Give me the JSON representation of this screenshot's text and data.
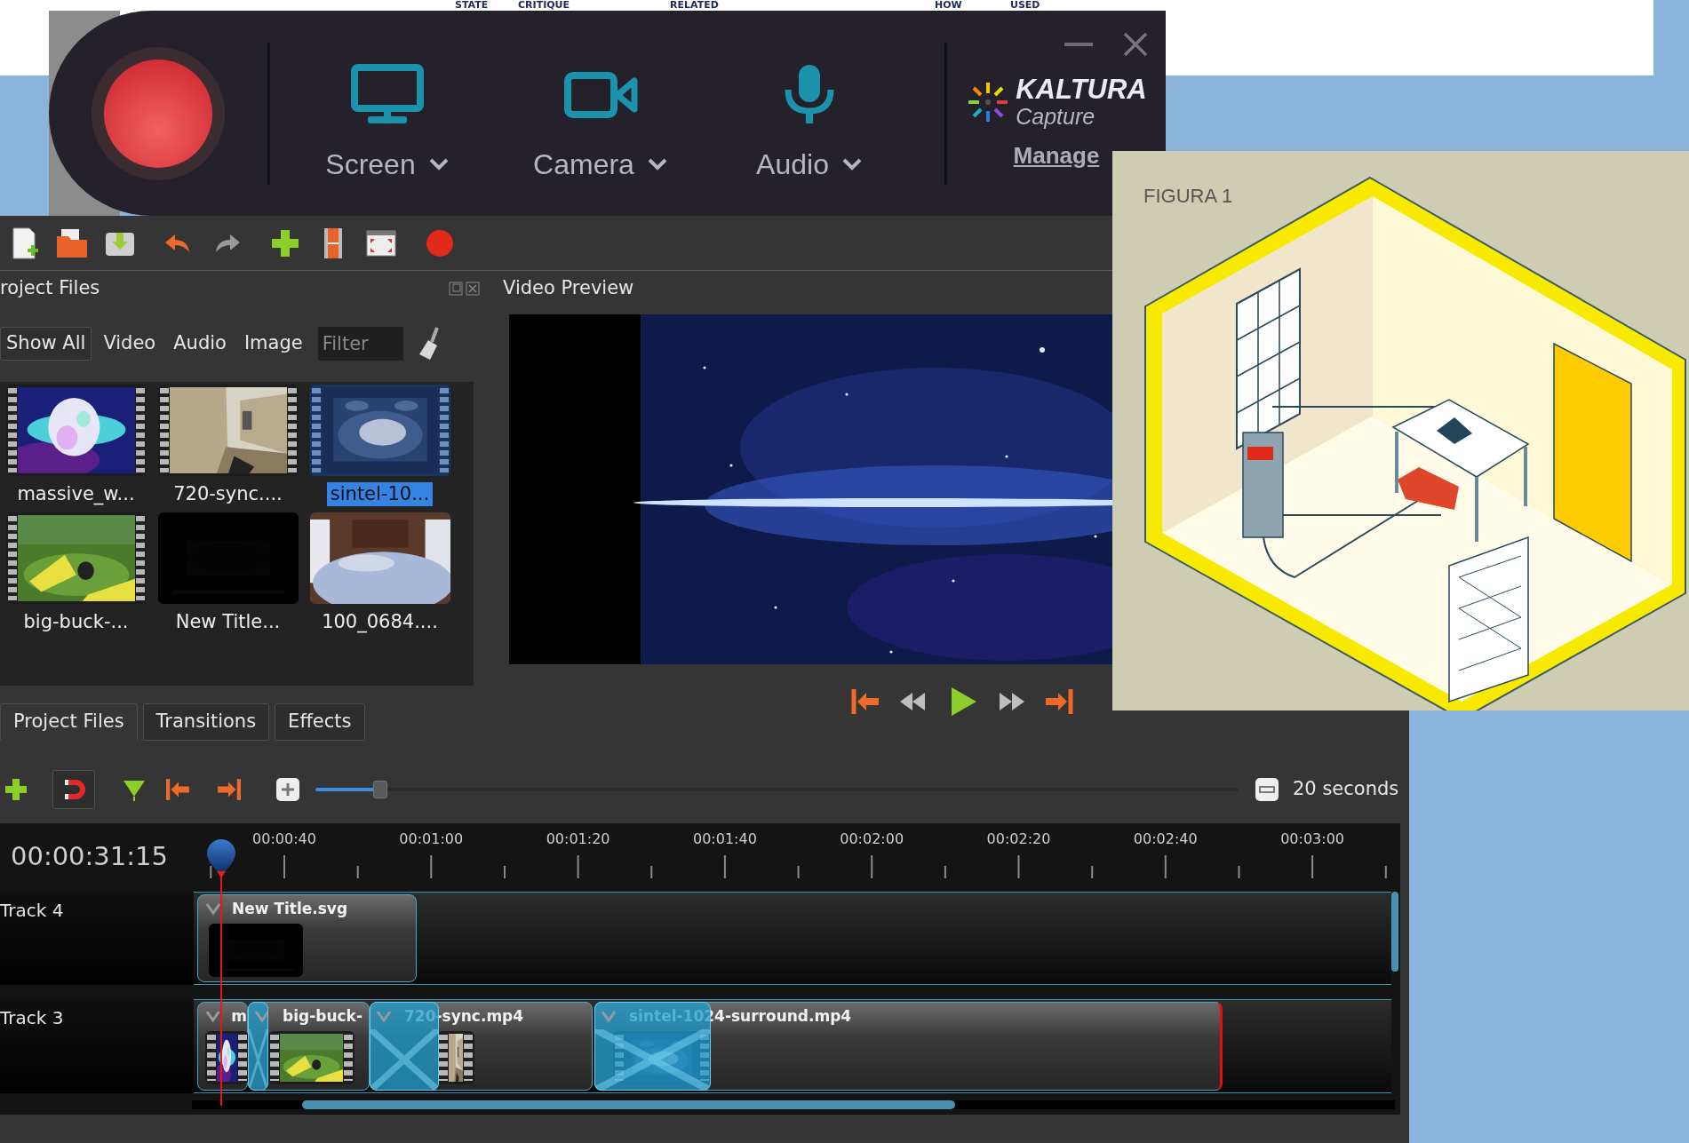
{
  "page_behind": {
    "words": [
      "STATE",
      "CRITIQUE",
      "RELATED",
      "HOW",
      "USED"
    ]
  },
  "recorder": {
    "sources": [
      {
        "label": "Screen",
        "kind": "screen"
      },
      {
        "label": "Camera",
        "kind": "camera"
      },
      {
        "label": "Audio",
        "kind": "audio"
      }
    ],
    "logo": {
      "name": "KALTURA",
      "product": "Capture"
    },
    "manage_link": "Manage"
  },
  "editor": {
    "project_files": {
      "title": "roject Files",
      "filters": [
        {
          "label": "Show All",
          "selected": true
        },
        {
          "label": "Video",
          "selected": false
        },
        {
          "label": "Audio",
          "selected": false
        },
        {
          "label": "Image",
          "selected": false
        }
      ],
      "filter_field": {
        "placeholder": "Filter"
      },
      "files": [
        {
          "label": "massive_w...",
          "kind": "video",
          "selected": false
        },
        {
          "label": "720-sync....",
          "kind": "video",
          "selected": false
        },
        {
          "label": "sintel-10...",
          "kind": "video",
          "selected": true
        },
        {
          "label": "big-buck-...",
          "kind": "video",
          "selected": false
        },
        {
          "label": "New Title...",
          "selected": false
        },
        {
          "label": "100_0684....",
          "selected": false
        }
      ]
    },
    "preview": {
      "title": "Video Preview"
    },
    "tabs": [
      {
        "label": "Project Files",
        "selected": true
      },
      {
        "label": "Transitions",
        "selected": false
      },
      {
        "label": "Effects",
        "selected": false
      }
    ],
    "timeline": {
      "zoom": {
        "level": 0.07,
        "reading": "20 seconds"
      },
      "timecode": "00:00:31:15",
      "ruler": [
        "00:00:40",
        "00:01:00",
        "00:01:20",
        "00:01:40",
        "00:02:00",
        "00:02:20",
        "00:02:40",
        "00:03:00"
      ],
      "tracks": [
        {
          "name": "Track 4",
          "clips": [
            {
              "title": "New Title.svg",
              "kind": "title"
            }
          ]
        },
        {
          "name": "Track 3",
          "clips": [
            {
              "title": "m",
              "kind": "video"
            },
            {
              "title": "big-buck-",
              "kind": "video"
            },
            {
              "title": "720-sync.mp4",
              "kind": "video"
            },
            {
              "title": "sintel-1024-surround.mp4",
              "kind": "video"
            }
          ]
        }
      ]
    }
  },
  "figure": {
    "caption": "FIGURA 1"
  }
}
